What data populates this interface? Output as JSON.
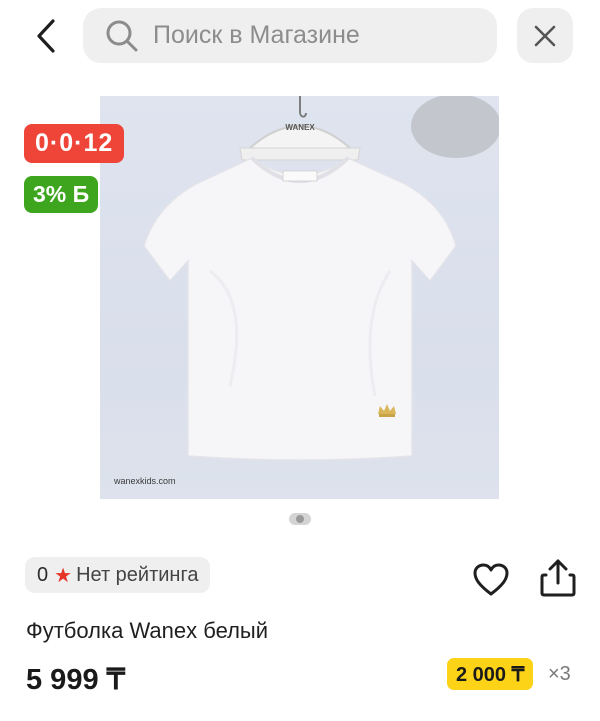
{
  "search": {
    "placeholder": "Поиск в Магазине"
  },
  "icons": {
    "back": "chevron-left-icon",
    "search": "search-icon",
    "close": "close-icon",
    "favorite": "heart-icon",
    "share": "share-icon",
    "rating_star": "star-icon"
  },
  "badges": {
    "installment": "0·0·12",
    "bonus": "3% Б"
  },
  "product": {
    "image_watermark": "wanexkids.com",
    "brand_tag": "WANEX",
    "title": "Футболка Wanex белый",
    "price": "5 999 ₸",
    "monthly_payment": "2 000 ₸",
    "monthly_multiplier": "×3"
  },
  "rating": {
    "count": "0",
    "label": "Нет рейтинга"
  },
  "gallery": {
    "current": 1,
    "total": 1
  },
  "colors": {
    "installment_badge": "#ef4438",
    "bonus_badge": "#3ea61e",
    "monthly_badge": "#fdd318",
    "rating_star": "#e63328"
  }
}
